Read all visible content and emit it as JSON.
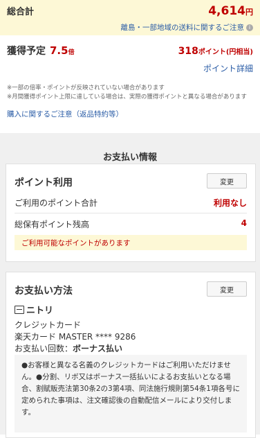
{
  "summary": {
    "total_label": "総合計",
    "total_amount": "4,614",
    "total_unit": "円",
    "shipping_notice": "離島・一部地域の送料に関するご注意",
    "earn_label": "獲得予定",
    "earn_rate": "7.5",
    "earn_rate_unit": "倍",
    "earn_points": "318",
    "earn_points_unit": "ポイント(円相当)",
    "point_detail_link": "ポイント詳細",
    "note1": "※一部の倍率・ポイントが反映されていない場合があります",
    "note2": "※月間獲得ポイント上限に達している場合は、実際の獲得ポイントと異なる場合があります",
    "purchase_caution_link": "購入に関するご注意（返品特約等）"
  },
  "payment_info": {
    "header": "お支払い情報",
    "points_card": {
      "title": "ポイント利用",
      "change_label": "変更",
      "used_label": "ご利用のポイント合計",
      "used_value": "利用なし",
      "balance_label": "総保有ポイント残高",
      "balance_value": "4",
      "available_notice": "ご利用可能なポイントがあります"
    },
    "method_card": {
      "title": "お支払い方法",
      "change_label": "変更",
      "store_name": "ニトリ",
      "method": "クレジットカード",
      "card": "楽天カード MASTER **** 9286",
      "installments_label": "お支払い回数：",
      "installments_value": "ボーナス払い",
      "note": "●お客様と異なる名義のクレジットカードはご利用いただけません。●分割、リボ又はボーナス一括払いによるお支払いとなる場合、割賦販売法第30条2の3第4項、同法施行規則第54条1項各号に定められた事項は、注文確認後の自動配信メールにより交付します。"
    }
  }
}
